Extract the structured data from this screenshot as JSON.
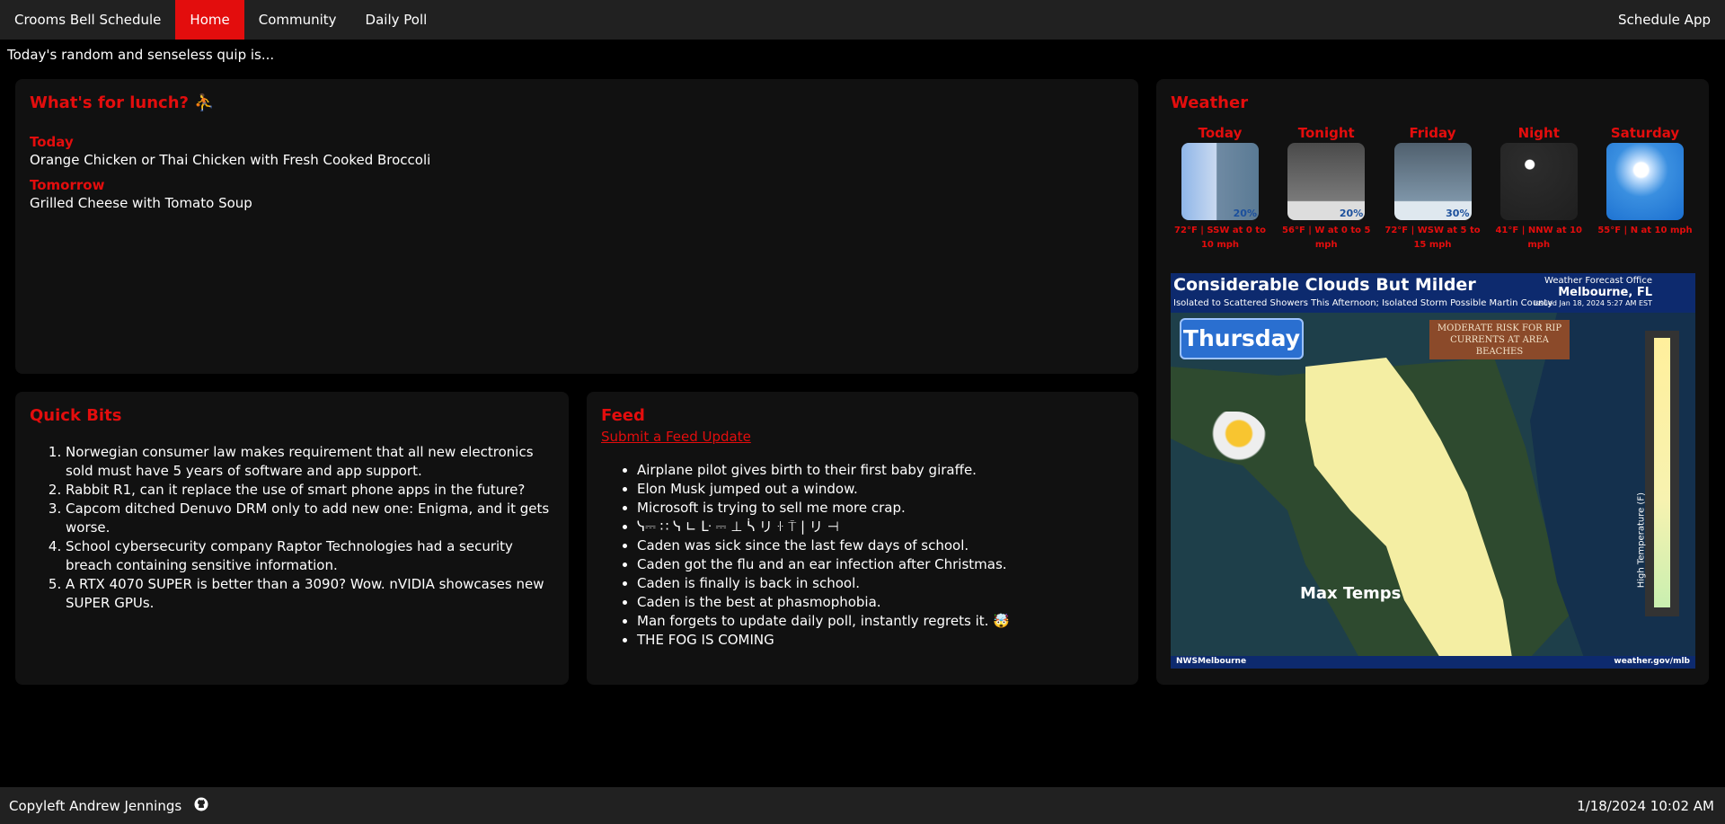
{
  "nav": {
    "brand": "Crooms Bell Schedule",
    "home": "Home",
    "community": "Community",
    "daily_poll": "Daily Poll",
    "schedule_app": "Schedule App"
  },
  "quip": "Today's random and senseless quip is...",
  "lunch": {
    "title": "What's for lunch? ⛹",
    "today_label": "Today",
    "today_menu": "Orange Chicken or Thai Chicken with Fresh Cooked Broccoli",
    "tomorrow_label": "Tomorrow",
    "tomorrow_menu": "Grilled Cheese with Tomato Soup"
  },
  "quick_bits": {
    "title": "Quick Bits",
    "items": [
      "Norwegian consumer law makes requirement that all new electronics sold must have 5 years of software and app support.",
      "Rabbit R1, can it replace the use of smart phone apps in the future?",
      "Capcom ditched Denuvo DRM only to add new one: Enigma, and it gets worse.",
      "School cybersecurity company Raptor Technologies had a security breach containing sensitive information.",
      "A RTX 4070 SUPER is better than a 3090? Wow. nVIDIA showcases new SUPER GPUs."
    ]
  },
  "feed": {
    "title": "Feed",
    "submit_link": "Submit a Feed Update",
    "items": [
      "Airplane pilot gives birth to their first baby giraffe.",
      "Elon Musk jumped out a window.",
      "Microsoft is trying to sell me more crap.",
      "ᓭ⎓ ∷ ᓭ ∟ ᒷ ⎓ ⊥ ᓵ リ ꖌ ⍑ | リ ⊣",
      "Caden was sick since the last few days of school.",
      "Caden got the flu and an ear infection after Christmas.",
      "Caden is finally is back in school.",
      "Caden is the best at phasmophobia.",
      "Man forgets to update daily poll, instantly regrets it. 🤯",
      "THE FOG IS COMING"
    ]
  },
  "weather": {
    "title": "Weather",
    "forecast": [
      {
        "name": "Today",
        "pct": "20%",
        "desc": "72°F | SSW at 0 to 10 mph"
      },
      {
        "name": "Tonight",
        "pct": "20%",
        "desc": "56°F | W at 0 to 5 mph"
      },
      {
        "name": "Friday",
        "pct": "30%",
        "desc": "72°F | WSW at 5 to 15 mph"
      },
      {
        "name": "Night",
        "pct": "",
        "desc": "41°F | NNW at 10 mph"
      },
      {
        "name": "Saturday",
        "pct": "",
        "desc": "55°F | N at 10 mph"
      }
    ],
    "map": {
      "title": "Considerable Clouds But Milder",
      "subtitle": "Isolated to Scattered Showers This Afternoon; Isolated Storm Possible Martin County",
      "office_label": "Weather Forecast Office",
      "office_city": "Melbourne, FL",
      "issued": "Issued Jan 18, 2024 5:27 AM EST",
      "day": "Thursday",
      "rip_current": "MODERATE RISK FOR RIP CURRENTS AT AREA BEACHES",
      "map_label": "Max Temps",
      "legend_title": "High Temperature (F)",
      "social": "NWSMelbourne",
      "website": "weather.gov/mlb"
    }
  },
  "footer": {
    "copyleft": "Copyleft Andrew Jennings",
    "datetime": "1/18/2024 10:02 AM"
  },
  "colors": {
    "accent": "#e30d0d",
    "nav_bg": "#212121",
    "card_bg": "#111111"
  }
}
